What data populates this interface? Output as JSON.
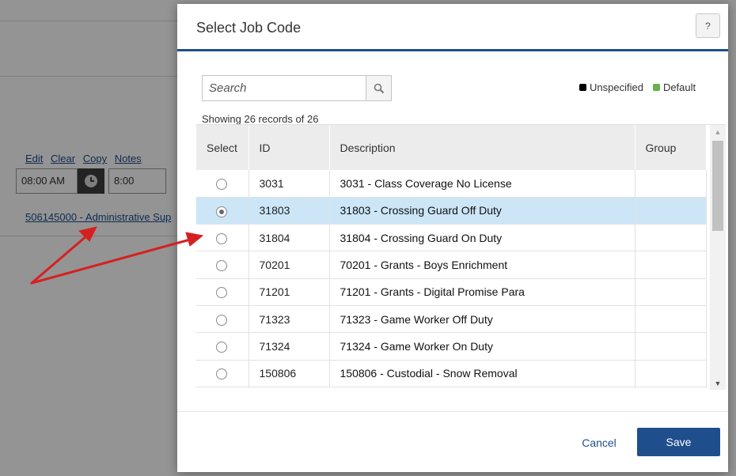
{
  "background": {
    "links": [
      "Edit",
      "Clear",
      "Copy",
      "Notes"
    ],
    "start_time": "08:00 AM",
    "hours": "8:00",
    "job_link": "506145000 - Administrative Sup"
  },
  "modal": {
    "title": "Select Job Code",
    "help_label": "?",
    "search_placeholder": "Search",
    "legend": [
      {
        "label": "Unspecified",
        "color": "#000000"
      },
      {
        "label": "Default",
        "color": "#6ab04c"
      }
    ],
    "record_count": "Showing 26 records of 26",
    "columns": [
      "Select",
      "ID",
      "Description",
      "Group"
    ],
    "rows": [
      {
        "id": "3031",
        "description": "3031 - Class Coverage No License",
        "group": "",
        "selected": false
      },
      {
        "id": "31803",
        "description": "31803 - Crossing Guard Off Duty",
        "group": "",
        "selected": true
      },
      {
        "id": "31804",
        "description": "31804 - Crossing Guard On Duty",
        "group": "",
        "selected": false
      },
      {
        "id": "70201",
        "description": "70201 - Grants - Boys Enrichment",
        "group": "",
        "selected": false
      },
      {
        "id": "71201",
        "description": "71201 - Grants - Digital Promise Para",
        "group": "",
        "selected": false
      },
      {
        "id": "71323",
        "description": "71323 - Game Worker Off Duty",
        "group": "",
        "selected": false
      },
      {
        "id": "71324",
        "description": "71324 - Game Worker On Duty",
        "group": "",
        "selected": false
      },
      {
        "id": "150806",
        "description": "150806 - Custodial - Snow Removal",
        "group": "",
        "selected": false
      }
    ],
    "cancel_label": "Cancel",
    "save_label": "Save"
  },
  "colors": {
    "accent": "#1f4e8c",
    "selected_row": "#cce6f8",
    "arrow": "#d62020"
  }
}
